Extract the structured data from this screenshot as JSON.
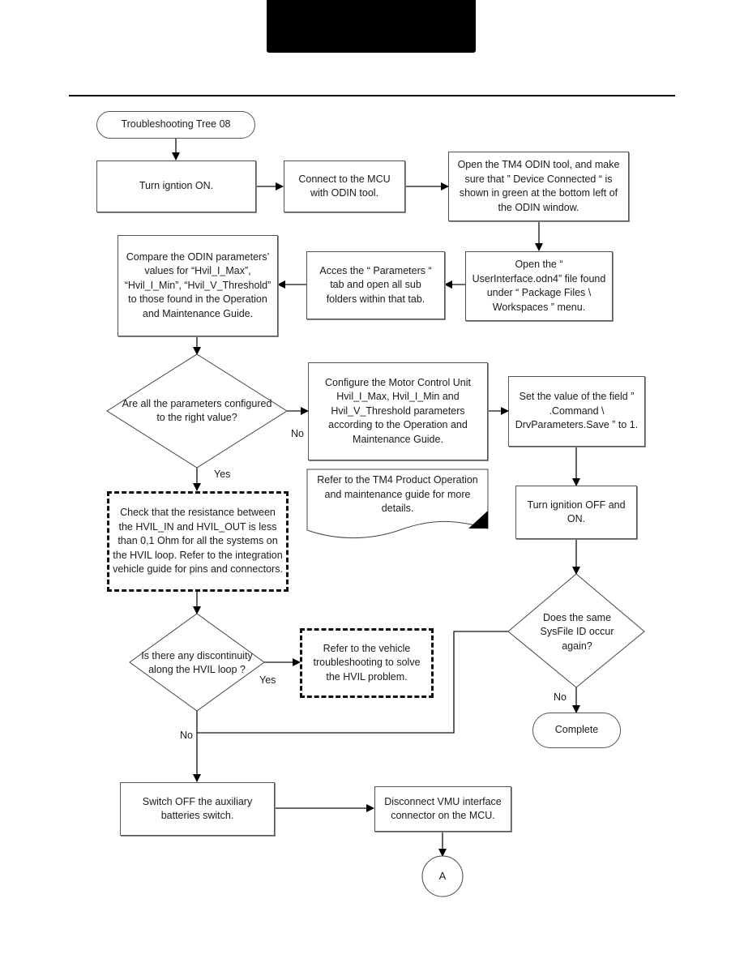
{
  "page": {
    "header_block": "black title bar",
    "divider": "horizontal rule"
  },
  "flowchart": {
    "start": "Troubleshooting Tree 08",
    "steps": {
      "ignition_on": "Turn igntion ON.",
      "connect_mcu": "Connect to the MCU with ODIN tool.",
      "open_odin": "Open the TM4 ODIN tool, and make sure that ” Device Connected “ is shown in green at the bottom left of the ODIN window.",
      "open_userinterface": "Open the “ UserInterface.odn4” file found under “ Package Files \\ Workspaces ” menu.",
      "access_parameters": "Acces the “ Parameters “ tab and open all sub folders within that tab.",
      "compare_parameters": "Compare the ODIN parameters’ values for “Hvil_I_Max”, “Hvil_I_Min”, “Hvil_V_Threshold” to those found in the Operation and Maintenance Guide.",
      "configure_mcu": "Configure the Motor Control Unit Hvil_I_Max, Hvil_I_Min and Hvil_V_Threshold parameters according to the Operation and Maintenance Guide.",
      "set_value": "Set the value of the field ” .Command \\ DrvParameters.Save ” to 1.",
      "refer_tm4_doc": "Refer to the TM4 Product Operation and maintenance guide for more details.",
      "check_resistance": "Check that the resistance between the HVIL_IN and HVIL_OUT is less than 0,1 Ohm for all the systems on the HVIL loop. Refer to the integration vehicle guide for pins and connectors.",
      "ignition_off_on": "Turn ignition OFF and ON.",
      "refer_vehicle": "Refer to the vehicle troubleshooting to solve the HVIL problem.",
      "switch_off_aux": "Switch OFF the auxiliary batteries switch.",
      "disconnect_vmu": "Disconnect VMU interface connector on the MCU."
    },
    "decisions": {
      "params_configured": "Are all the parameters configured to the right value?",
      "discontinuity": "Is there any discontinuity along the HVIL loop ?",
      "sysfile_again": "Does the same SysFile ID occur again?"
    },
    "edge_labels": {
      "params_no": "No",
      "params_yes": "Yes",
      "disc_yes": "Yes",
      "disc_no": "No",
      "sysfile_no": "No"
    },
    "end": "Complete",
    "connector": "A"
  }
}
